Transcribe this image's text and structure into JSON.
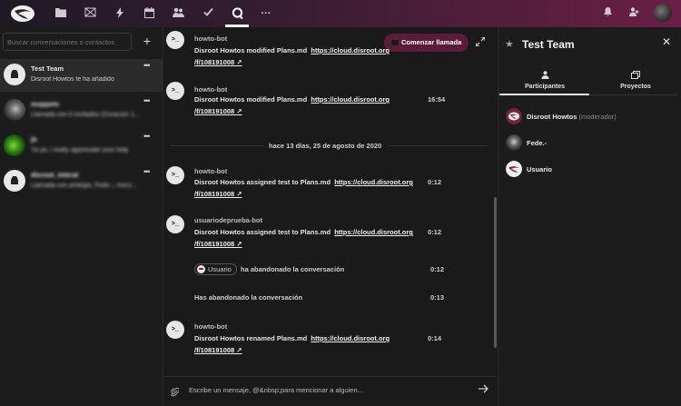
{
  "topbar": {
    "icons": [
      "logo-icon",
      "folder-icon",
      "photo-icon",
      "bolt-icon",
      "calendar-icon",
      "contacts-icon",
      "check-icon",
      "talk-icon",
      "more-icon",
      "bell-icon",
      "people-icon"
    ],
    "active_app": "talk-icon",
    "accent": "#6b1f45"
  },
  "sidebar": {
    "search_placeholder": "Buscar conversaciones o contactos",
    "conversations": [
      {
        "name": "Test Team",
        "subtitle": "Disroot Howtos te ha añadido",
        "active": true
      },
      {
        "name": "muppets",
        "subtitle": "Llamada con 0 invitados (Duración 1...",
        "blurred": true
      },
      {
        "name": "jh",
        "subtitle": "Ya ya, I really appreciate your help",
        "blurred": true
      },
      {
        "name": "disroot_interal",
        "subtitle": "Llamada con antilope, Fede.-, mecc...",
        "blurred": true
      }
    ]
  },
  "chat": {
    "call_button": "Comenzar llamada",
    "day_separator": "hace 13 días, 25 de agosto de 2020",
    "messages": [
      {
        "author": "howto-bot",
        "text": "Disroot Howtos modified Plans.md",
        "link": "https://cloud.disroot.org",
        "link2": "/f/108191008 ↗",
        "time": ""
      },
      {
        "author": "howto-bot",
        "text": "Disroot Howtos modified Plans.md",
        "link": "https://cloud.disroot.org",
        "link2": "/f/108191008 ↗",
        "time": "16:54"
      },
      {
        "author": "howto-bot",
        "text": "Disroot Howtos assigned test to Plans.md",
        "link": "https://cloud.disroot.org",
        "link2": "/f/108191008 ↗",
        "time": "0:12"
      },
      {
        "author": "usuariodeprueba-bot",
        "text": "Disroot Howtos assigned test to Plans.md",
        "link": "https://cloud.disroot.org",
        "link2": "/f/108191008 ↗",
        "time": "0:12"
      },
      {
        "author": "",
        "badge": "Usuario",
        "text": "ha abandonado la conversación",
        "time": "0:12"
      },
      {
        "author": "",
        "text": "Has abandonado la conversación",
        "time": "0:13"
      },
      {
        "author": "howto-bot",
        "text": "Disroot Howtos renamed Plans.md",
        "link": "https://cloud.disroot.org",
        "link2": "/f/108191008 ↗",
        "time": "0:14"
      }
    ],
    "bot_avatar_text": ">_",
    "compose_placeholder": "Escribe un mensaje, @&nbsp;para mencionar a alguien..."
  },
  "room_panel": {
    "title": "Test Team",
    "tabs": [
      {
        "label": "Participantes",
        "active": true
      },
      {
        "label": "Proyectos",
        "active": false
      }
    ],
    "participants": [
      {
        "name": "Disroot Howtos",
        "role": "(moderador)"
      },
      {
        "name": "Fede.-",
        "role": ""
      },
      {
        "name": "Usuario",
        "role": ""
      }
    ]
  }
}
